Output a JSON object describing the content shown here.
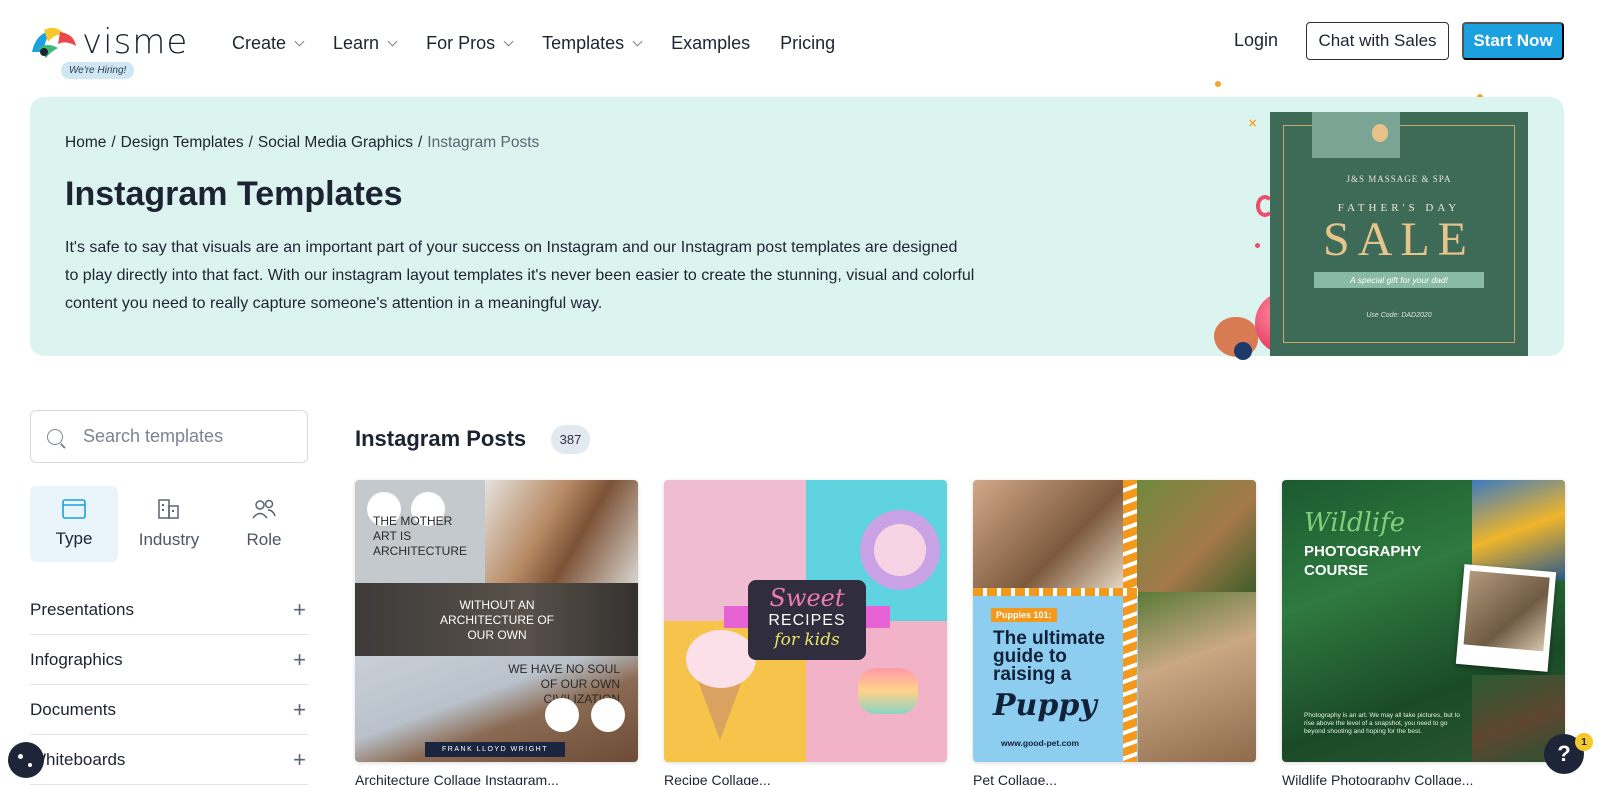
{
  "header": {
    "logo_text": "visme",
    "hiring_badge": "We're Hiring!",
    "nav": [
      {
        "label": "Create",
        "dropdown": true
      },
      {
        "label": "Learn",
        "dropdown": true
      },
      {
        "label": "For Pros",
        "dropdown": true
      },
      {
        "label": "Templates",
        "dropdown": true
      },
      {
        "label": "Examples",
        "dropdown": false
      },
      {
        "label": "Pricing",
        "dropdown": false
      }
    ],
    "login": "Login",
    "chat_with_sales": "Chat with Sales",
    "start_now": "Start Now"
  },
  "hero": {
    "breadcrumb": [
      "Home",
      "Design Templates",
      "Social Media Graphics",
      "Instagram Posts"
    ],
    "title": "Instagram Templates",
    "description": "It's safe to say that visuals are an important part of your success on Instagram and our Instagram post templates are designed to play directly into that fact. With our instagram layout templates it's never been easier to create the stunning, visual and colorful content you need to really capture someone's attention in a meaningful way.",
    "promo": {
      "spa": "J&S MASSAGE & SPA",
      "day": "FATHER'S DAY",
      "sale": "SALE",
      "ribbon": "A special gift for your dad!",
      "code": "Use Code: DAD2020"
    }
  },
  "sidebar": {
    "search_placeholder": "Search templates",
    "tabs": [
      {
        "label": "Type",
        "icon": "browser-window-icon",
        "active": true
      },
      {
        "label": "Industry",
        "icon": "buildings-icon",
        "active": false
      },
      {
        "label": "Role",
        "icon": "users-icon",
        "active": false
      }
    ],
    "categories": [
      "Presentations",
      "Infographics",
      "Documents",
      "Whiteboards"
    ]
  },
  "main": {
    "section_title": "Instagram Posts",
    "count": "387",
    "cards": [
      {
        "label": "Architecture Collage Instagram...",
        "lines": [
          "THE MOTHER ART IS ARCHITECTURE",
          "WITHOUT AN ARCHITECTURE OF OUR OWN",
          "WE HAVE NO SOUL OF OUR OWN CIVILIZATION"
        ],
        "author": "FRANK LLOYD WRIGHT"
      },
      {
        "label": "Recipe Collage...",
        "sweet": "Sweet",
        "recipes": "RECIPES",
        "kids": "for kids"
      },
      {
        "label": "Pet Collage...",
        "tag": "Puppies 101:",
        "headline": "The ultimate guide to raising a",
        "puppy": "Puppy",
        "url": "www.good-pet.com"
      },
      {
        "label": "Wildlife Photography Collage...",
        "wildlife": "Wildlife",
        "photography": "PHOTOGRAPHY COURSE",
        "small": "Photography is an art. We may all take pictures, but to rise above the level of a snapshot, you need to go beyond shooting and hoping for the best."
      }
    ]
  },
  "help": {
    "label": "?",
    "badge": "1"
  },
  "colors": {
    "accent": "#1ba0e0",
    "hero_bg": "#dcf4f0",
    "text": "#1d2333"
  }
}
